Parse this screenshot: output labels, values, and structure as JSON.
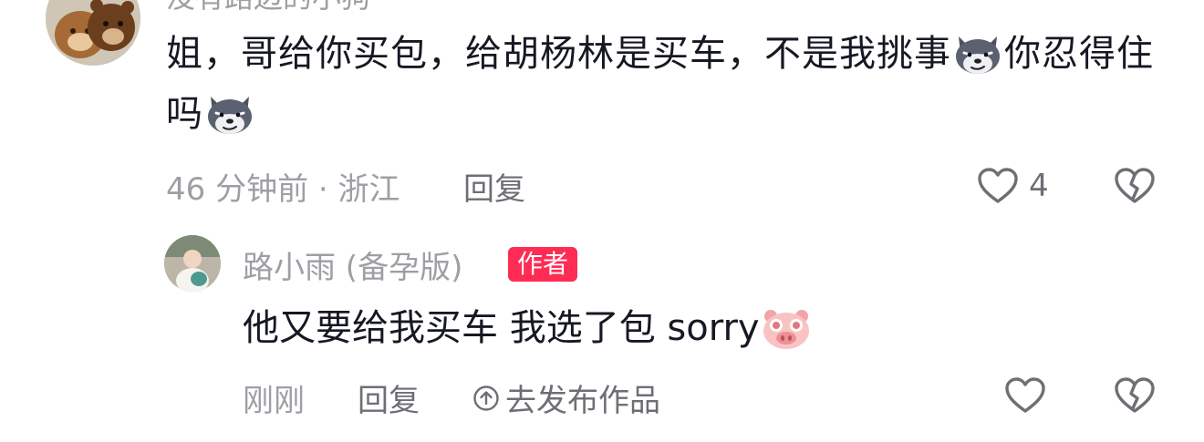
{
  "top_comment": {
    "username": "没有路边的小狗",
    "text_part1": "姐，哥给你买包，给胡杨林是买车，不是我挑事",
    "text_part2": "你忍得住吗",
    "time_location": "46 分钟前 · 浙江",
    "reply_label": "回复",
    "like_count": "4"
  },
  "reply_comment": {
    "username": "路小雨 (备孕版)",
    "author_badge": "作者",
    "text": "他又要给我买车 我选了包 sorry",
    "time": "刚刚",
    "reply_label": "回复",
    "publish_label": "去发布作品"
  },
  "icons": {
    "emoji_wolf": "wolf-smirk-emoji",
    "emoji_pig": "pig-face-emoji",
    "like": "heart-outline-icon",
    "dislike": "broken-heart-icon",
    "publish": "up-arrow-circle-icon"
  },
  "colors": {
    "text_primary": "#161823",
    "text_secondary": "#9e9fa4",
    "author_badge_bg": "#fe2c55"
  }
}
